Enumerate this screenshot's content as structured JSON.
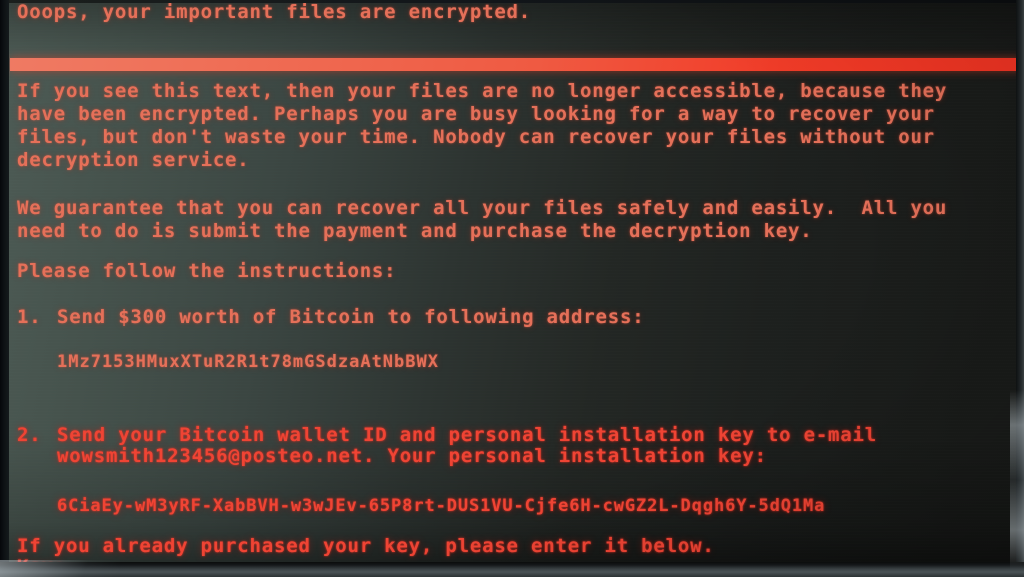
{
  "screen": {
    "kind": "ransomware-lock-screen",
    "title": "Ooops, your important files are encrypted.",
    "colors": {
      "text_red": "#e4604b",
      "bar_red": "#ef5a42",
      "background_left": "#4d5b55",
      "background_right": "#191b19"
    },
    "intro_lines": [
      "If you see this text, then your files are no longer accessible, because they",
      "have been encrypted. Perhaps you are busy looking for a way to recover your",
      "files, but don't waste your time. Nobody can recover your files without our",
      "decryption service."
    ],
    "guarantee_lines": [
      "We guarantee that you can recover all your files safely and easily.  All you",
      "need to do is submit the payment and purchase the decryption key."
    ],
    "instructions_header": "Please follow the instructions:",
    "steps": [
      {
        "number": "1.",
        "lines": [
          "Send $300 worth of Bitcoin to following address:"
        ],
        "value": "1Mz7153HMuxXTuR2R1t78mGSdzaAtNbBWX",
        "value_kind": "bitcoin-address"
      },
      {
        "number": "2.",
        "lines": [
          "Send your Bitcoin wallet ID and personal installation key to e-mail",
          "wowsmith123456@posteo.net. Your personal installation key:"
        ],
        "value": "6CiaEy-wM3yRF-XabBVH-w3wJEv-65P8rt-DUS1VU-Cjfe6H-cwGZ2L-Dqgh6Y-5dQ1Ma",
        "value_kind": "installation-key"
      }
    ],
    "ransom_amount": "$300",
    "email": "wowsmith123456@posteo.net",
    "footer_prompt": "If you already purchased your key, please enter it below.",
    "key_label": "Key:",
    "key_input_value": ""
  }
}
